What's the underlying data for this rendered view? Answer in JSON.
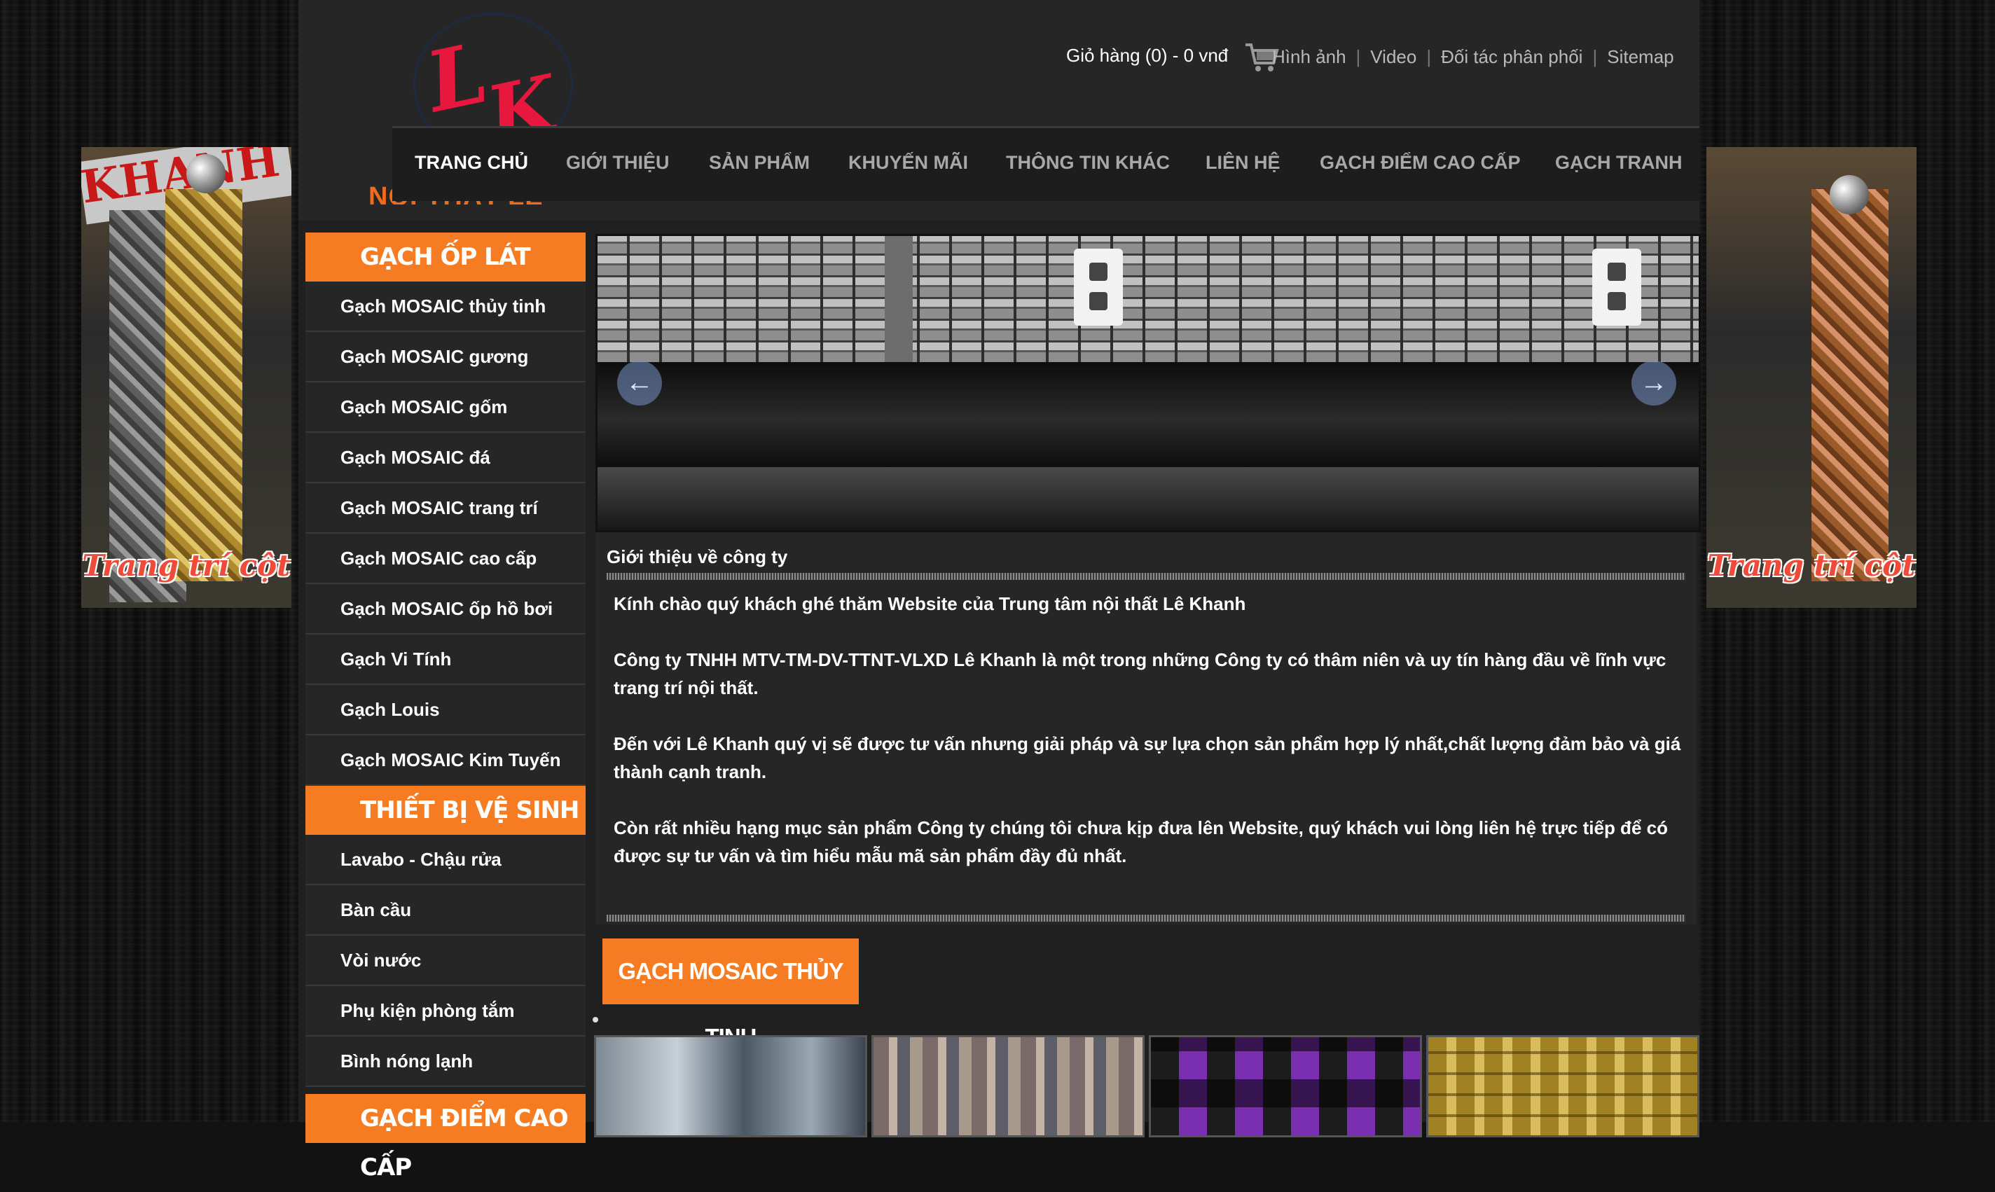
{
  "header": {
    "logo_text": "LK",
    "subtitle": "NỘI THẤT LÊ KHANH",
    "cart_label": "Giỏ hàng (0) - 0 vnđ",
    "top_links": [
      "Hình ảnh",
      "Video",
      "Đối tác phân phối",
      "Sitemap"
    ]
  },
  "nav": {
    "items": [
      "TRANG CHỦ",
      "GIỚI THIỆU",
      "SẢN PHẨM",
      "KHUYẾN MÃI",
      "THÔNG TIN KHÁC",
      "LIÊN HỆ",
      "GẠCH ĐIỂM CAO CẤP",
      "GẠCH TRANH"
    ],
    "active": "TRANG CHỦ"
  },
  "banners": {
    "left_caption": "Trang trí cột",
    "left_sign": "KHANH",
    "right_caption": "Trang trí cột"
  },
  "sidebar": {
    "categories": [
      {
        "title": "GẠCH ỐP LÁT",
        "items": [
          "Gạch MOSAIC thủy tinh",
          "Gạch MOSAIC gương",
          "Gạch MOSAIC gốm",
          "Gạch MOSAIC đá",
          "Gạch MOSAIC trang trí",
          "Gạch MOSAIC cao cấp",
          "Gạch MOSAIC ốp hồ bơi",
          "Gạch Vi Tính",
          "Gạch Louis",
          "Gạch MOSAIC Kim Tuyến"
        ]
      },
      {
        "title": "THIẾT BỊ VỆ SINH",
        "items": [
          "Lavabo - Chậu rửa",
          "Bàn cầu",
          "Vòi nước",
          "Phụ kiện phòng tắm",
          "Bình nóng lạnh"
        ]
      },
      {
        "title": "GẠCH ĐIỂM CAO CẤP",
        "items": []
      }
    ]
  },
  "slider": {
    "prev_icon": "arrow-left-icon",
    "next_icon": "arrow-right-icon"
  },
  "intro": {
    "title": "Giới thiệu về công ty",
    "paragraphs": [
      "Kính chào quý khách ghé thăm Website của Trung tâm nội thất Lê Khanh",
      "Công ty TNHH MTV-TM-DV-TTNT-VLXD Lê Khanh là một trong những Công ty có thâm niên và uy tín hàng đầu về lĩnh vực trang trí nội thất.",
      "Đến với Lê Khanh quý vị sẽ được tư vấn nhưng giải pháp và sự lựa chọn sản phẩm hợp lý nhất,chất lượng đảm bảo và giá thành cạnh tranh.",
      "Còn rất nhiều hạng mục sản phẩm Công ty chúng tôi chưa kịp đưa lên Website, quý khách vui lòng liên hệ trực tiếp để có được sự tư vấn và tìm hiểu mẫu mã sản phẩm đầy đủ nhất."
    ]
  },
  "products": {
    "section_title": "GẠCH MOSAIC THỦY TINH"
  },
  "colors": {
    "accent": "#f57c22",
    "logo_red": "#e8173d",
    "background": "#202020"
  }
}
